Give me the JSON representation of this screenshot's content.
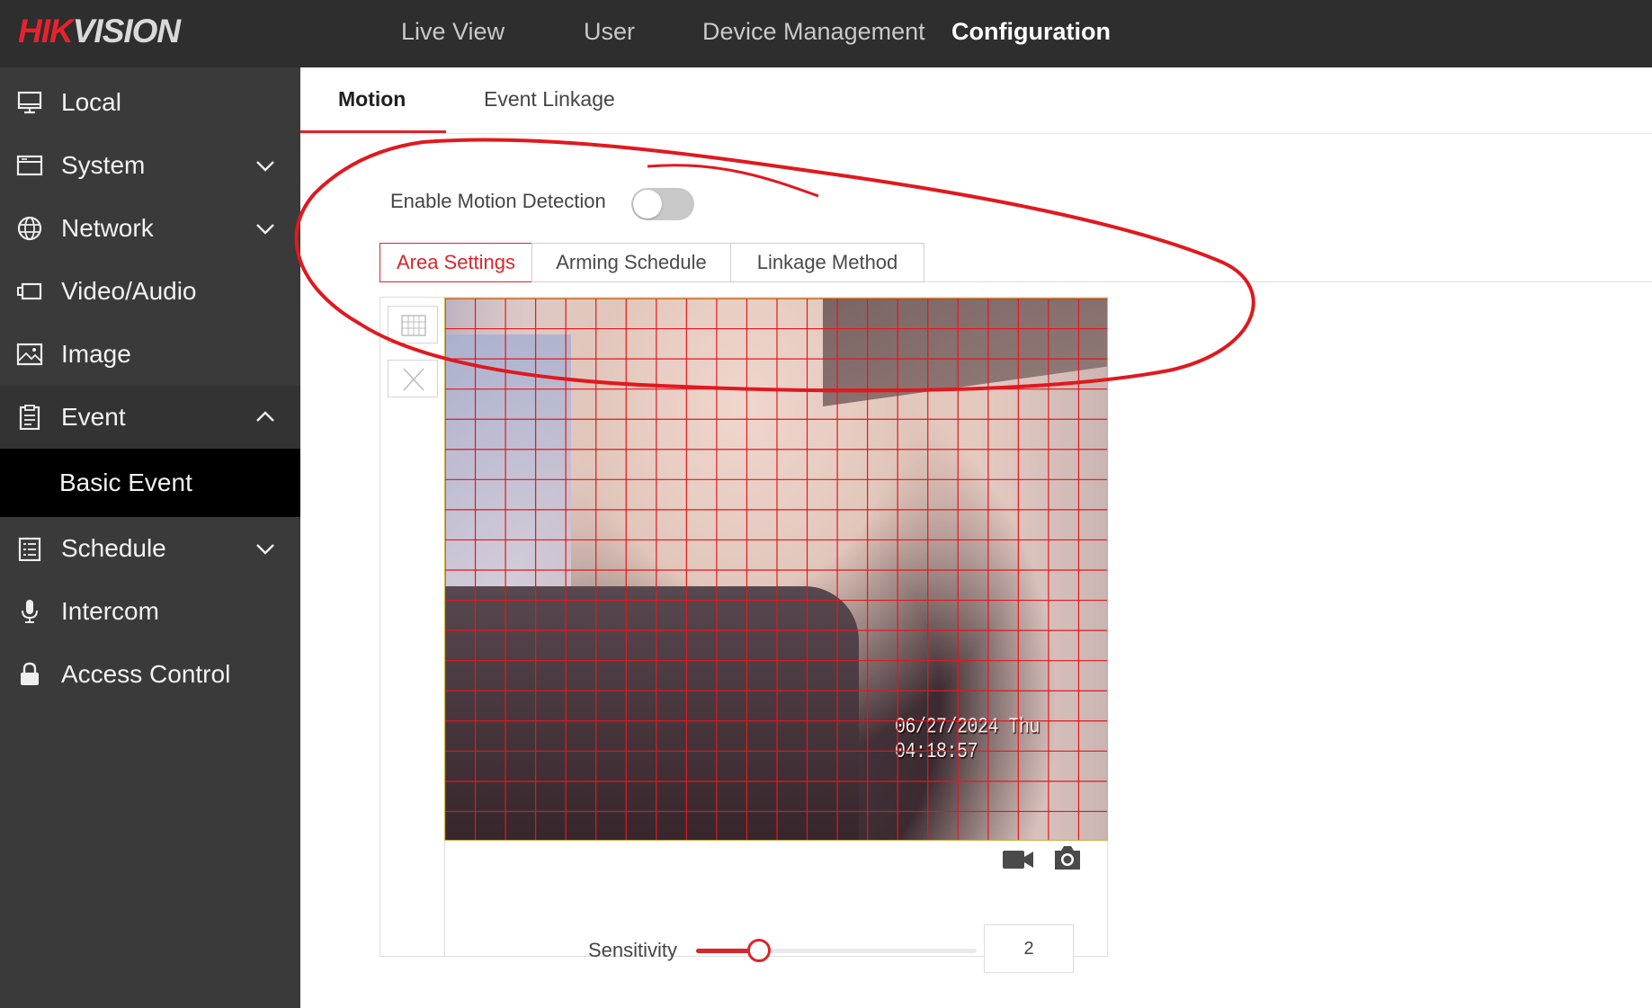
{
  "brand": {
    "logo_part1": "HIK",
    "logo_part2": "VISION",
    "logo_text": "HIKVISION"
  },
  "topnav": {
    "items": [
      {
        "label": "Live View"
      },
      {
        "label": "User"
      },
      {
        "label": "Device Management"
      },
      {
        "label": "Configuration",
        "active": true
      }
    ]
  },
  "sidebar": {
    "items": [
      {
        "label": "Local",
        "icon": "monitor-icon"
      },
      {
        "label": "System",
        "icon": "window-icon",
        "expandable": true
      },
      {
        "label": "Network",
        "icon": "globe-icon",
        "expandable": true
      },
      {
        "label": "Video/Audio",
        "icon": "camera-icon"
      },
      {
        "label": "Image",
        "icon": "image-icon"
      },
      {
        "label": "Event",
        "icon": "clipboard-icon",
        "expandable": true,
        "expanded": true
      },
      {
        "label": "Basic Event",
        "selected": true
      },
      {
        "label": "Schedule",
        "icon": "schedule-icon",
        "expandable": true
      },
      {
        "label": "Intercom",
        "icon": "microphone-icon"
      },
      {
        "label": "Access Control",
        "icon": "lock-icon"
      }
    ]
  },
  "main": {
    "tabs": [
      {
        "label": "Motion",
        "active": true
      },
      {
        "label": "Event Linkage"
      }
    ],
    "enable_motion": {
      "label": "Enable Motion Detection",
      "enabled": false
    },
    "subtabs": [
      {
        "label": "Area Settings",
        "active": true
      },
      {
        "label": "Arming Schedule"
      },
      {
        "label": "Linkage Method"
      }
    ],
    "video": {
      "osd_timestamp": "06/27/2024 Thu 04:18:57",
      "grid": {
        "columns": 22,
        "rows": 18,
        "all_selected": true
      }
    },
    "sensitivity": {
      "label": "Sensitivity",
      "value": "2"
    }
  },
  "colors": {
    "accent": "#d9262c",
    "topbar": "#2e2e2e",
    "sidebar": "#3a3a3a",
    "selected_item": "#000000"
  }
}
